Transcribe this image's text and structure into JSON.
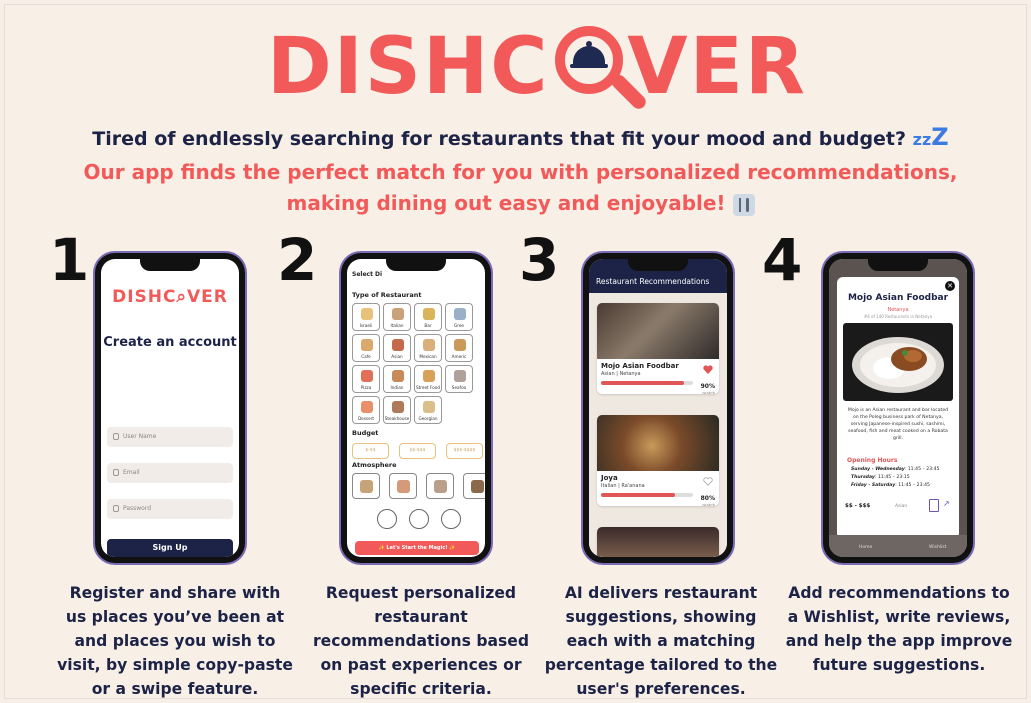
{
  "logo": {
    "left_text": "DISHC",
    "right_text": "VER"
  },
  "tagline": {
    "question": "Tired of endlessly searching for restaurants that fit your mood and budget?",
    "zzz": "zz",
    "zzz_big": "Z",
    "answer_line1": "Our app finds the perfect match for you with personalized recommendations,",
    "answer_line2": "making dining out easy and enjoyable!"
  },
  "steps": [
    {
      "number": "1",
      "caption": "Register and share with us places you’ve been at and places you wish to visit,  by simple copy-paste or a swipe feature."
    },
    {
      "number": "2",
      "caption": "Request personalized restaurant recommendations based on past experiences or specific criteria."
    },
    {
      "number": "3",
      "caption": "AI delivers restaurant suggestions, showing each with a matching percentage tailored to the user's preferences."
    },
    {
      "number": "4",
      "caption": "Add recommendations to a Wishlist, write reviews, and help the app improve future suggestions."
    }
  ],
  "phone1": {
    "logo": "DISHC⌕VER",
    "title": "Create an account",
    "fields": [
      "User Name",
      "Email",
      "Password"
    ],
    "button": "Sign Up"
  },
  "phone2": {
    "header": "Select Di",
    "type_label": "Type of Restaurant",
    "types": [
      "Israeli",
      "Italian",
      "Bar",
      "Gree",
      "Cafe",
      "Asian",
      "Mexican",
      "Americ",
      "Pizza",
      "Indian",
      "Street Food",
      "Seafoo",
      "Dessert",
      "Steakhouse",
      "Georgian"
    ],
    "budget_label": "Budget",
    "budgets": [
      "$-$$",
      "$$-$$$",
      "$$$-$$$$"
    ],
    "atmosphere_label": "Atmosphere",
    "button": "✨ Let's Start the Magic! ✨"
  },
  "phone3": {
    "header": "Restaurant Recommendations",
    "cards": [
      {
        "name": "Mojo Asian Foodbar",
        "sub": "Asian | Netanya",
        "match": "90%",
        "match_label": "match",
        "match_value": 90,
        "liked": true
      },
      {
        "name": "Joya",
        "sub": "Italian | Ra'anana",
        "match": "80%",
        "match_label": "match",
        "match_value": 80,
        "liked": false
      }
    ]
  },
  "phone4": {
    "title": "Mojo Asian Foodbar",
    "city": "Netanya",
    "rank": "#4 of 140 Restaurants in Netanya",
    "description": "Mojo is an Asian restaurant and bar located on the Poleg business park of Netanya, serving Japanese-inspired sushi, sashimi, seafood, fish and meat cooked on a Robata grill.",
    "opening_label": "Opening Hours",
    "hours": [
      {
        "days": "Sunday - Wednesday",
        "time": "11:45 – 23:45"
      },
      {
        "days": "Thursday",
        "time": "11:45 – 23:15"
      },
      {
        "days": "Friday - Saturday",
        "time": "11:45 – 23:45"
      }
    ],
    "price": "$$ - $$$",
    "cuisine": "Asian",
    "nav_home": "Home",
    "nav_wishlist": "Wishlist"
  },
  "colors": {
    "brand_red": "#f25a5a",
    "navy": "#1d2347",
    "background": "#f8efe6"
  }
}
